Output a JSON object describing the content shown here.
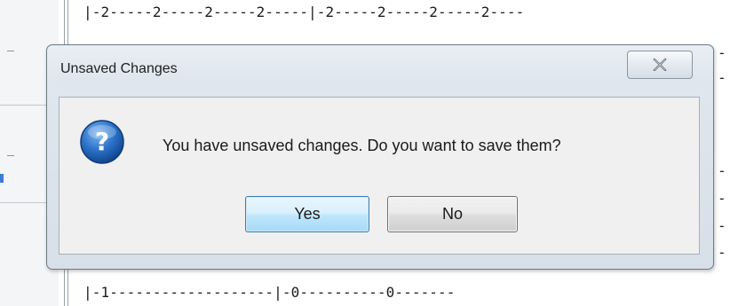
{
  "dialog": {
    "title": "Unsaved Changes",
    "message": "You have unsaved changes. Do you want to save them?",
    "yes_label": "Yes",
    "no_label": "No",
    "icon": "question-icon",
    "close_icon": "close-icon"
  },
  "editor": {
    "tab_top": "|-2-----2-----2-----2-----|-2-----2-----2-----2----",
    "tab_bottom": "|-1-------------------|-0----------0-------",
    "right_ticks": [
      "-",
      "-",
      "-",
      "-",
      "-",
      "-"
    ]
  },
  "colors": {
    "dialog_border": "#6f7a86",
    "yes_border": "#3c7fb1",
    "question_blue": "#1f63b8"
  }
}
